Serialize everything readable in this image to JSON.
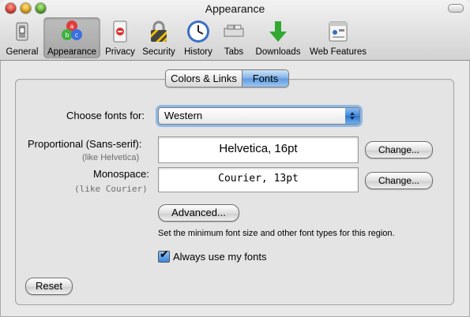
{
  "window": {
    "title": "Appearance"
  },
  "toolbar": {
    "items": [
      {
        "label": "General",
        "icon": "switch-icon",
        "selected": false
      },
      {
        "label": "Appearance",
        "icon": "abc-color-balls-icon",
        "selected": true
      },
      {
        "label": "Privacy",
        "icon": "privacy-sign-icon",
        "selected": false
      },
      {
        "label": "Security",
        "icon": "padlock-icon",
        "selected": false
      },
      {
        "label": "History",
        "icon": "clock-icon",
        "selected": false
      },
      {
        "label": "Tabs",
        "icon": "tabs-icon",
        "selected": false
      },
      {
        "label": "Downloads",
        "icon": "download-arrow-icon",
        "selected": false
      },
      {
        "label": "Web Features",
        "icon": "web-features-icon",
        "selected": false
      }
    ]
  },
  "tabs": {
    "items": [
      {
        "label": "Colors & Links",
        "selected": false
      },
      {
        "label": "Fonts",
        "selected": true
      }
    ]
  },
  "fonts": {
    "choose_label": "Choose fonts for:",
    "choose_value": "Western",
    "proportional_label": "Proportional (Sans-serif):",
    "proportional_hint": "(like Helvetica)",
    "proportional_value": "Helvetica, 16pt",
    "monospace_label": "Monospace:",
    "monospace_hint": "(like Courier)",
    "monospace_value": "Courier, 13pt",
    "change_label": "Change...",
    "advanced_label": "Advanced...",
    "advanced_description": "Set the minimum font size and other font types for this region.",
    "always_use_label": "Always use my fonts",
    "always_use_checked": true
  },
  "footer": {
    "reset_label": "Reset"
  },
  "colors": {
    "accent": "#3f87dc",
    "selected_tab": "#7fb2e6"
  }
}
